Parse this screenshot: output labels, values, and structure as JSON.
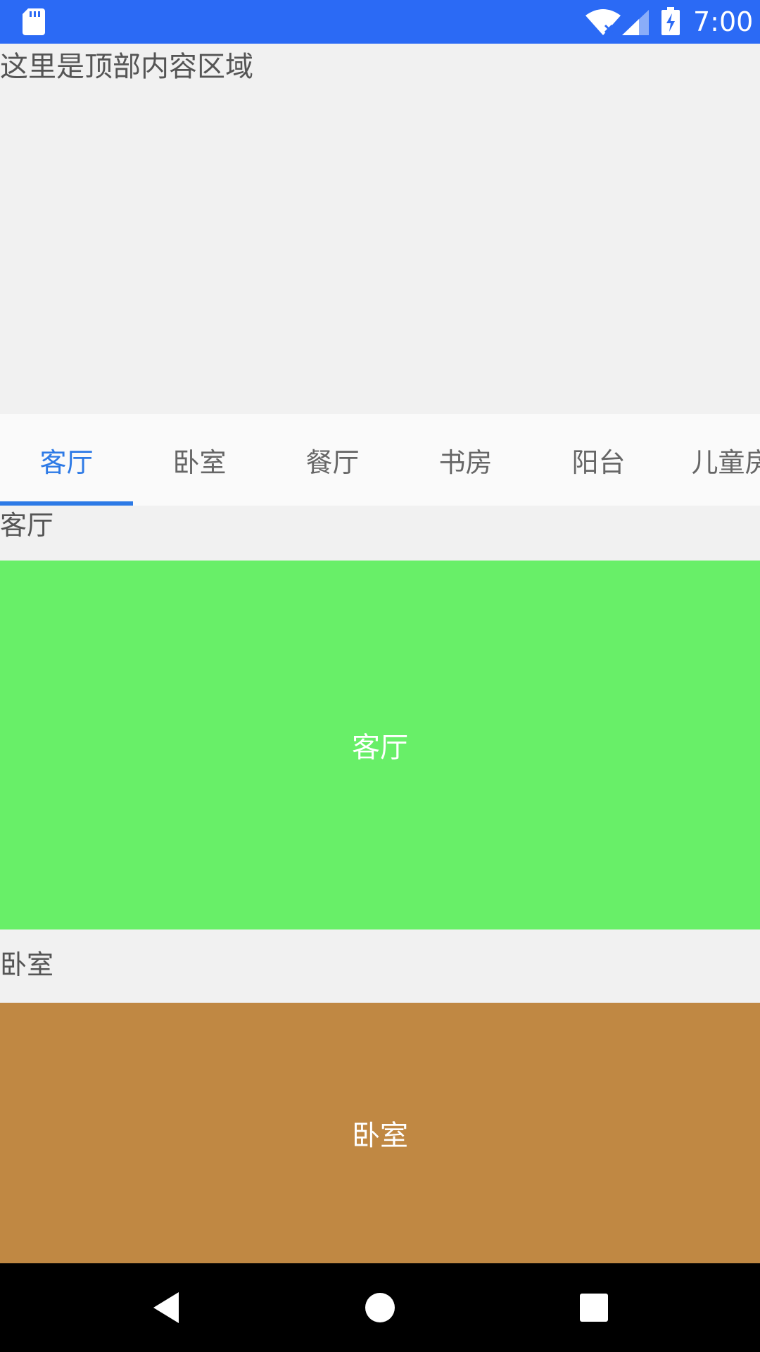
{
  "status_bar": {
    "time": "7:00",
    "background_color": "#2b6af5",
    "icons": [
      "sd-card-icon",
      "wifi-icon",
      "cellular-signal-icon",
      "battery-charging-icon"
    ]
  },
  "top_area": {
    "text": "这里是顶部内容区域"
  },
  "tabs": [
    {
      "label": "客厅",
      "active": true
    },
    {
      "label": "卧室",
      "active": false
    },
    {
      "label": "餐厅",
      "active": false
    },
    {
      "label": "书房",
      "active": false
    },
    {
      "label": "阳台",
      "active": false
    },
    {
      "label": "儿童房",
      "active": false
    }
  ],
  "accent_color": "#2d7ae6",
  "sections": [
    {
      "header": "客厅",
      "panel_label": "客厅",
      "color": "#68ef68"
    },
    {
      "header": "卧室",
      "panel_label": "卧室",
      "color": "#c08843"
    }
  ],
  "nav_bar": {
    "buttons": [
      "back-icon",
      "home-icon",
      "recents-icon"
    ]
  }
}
